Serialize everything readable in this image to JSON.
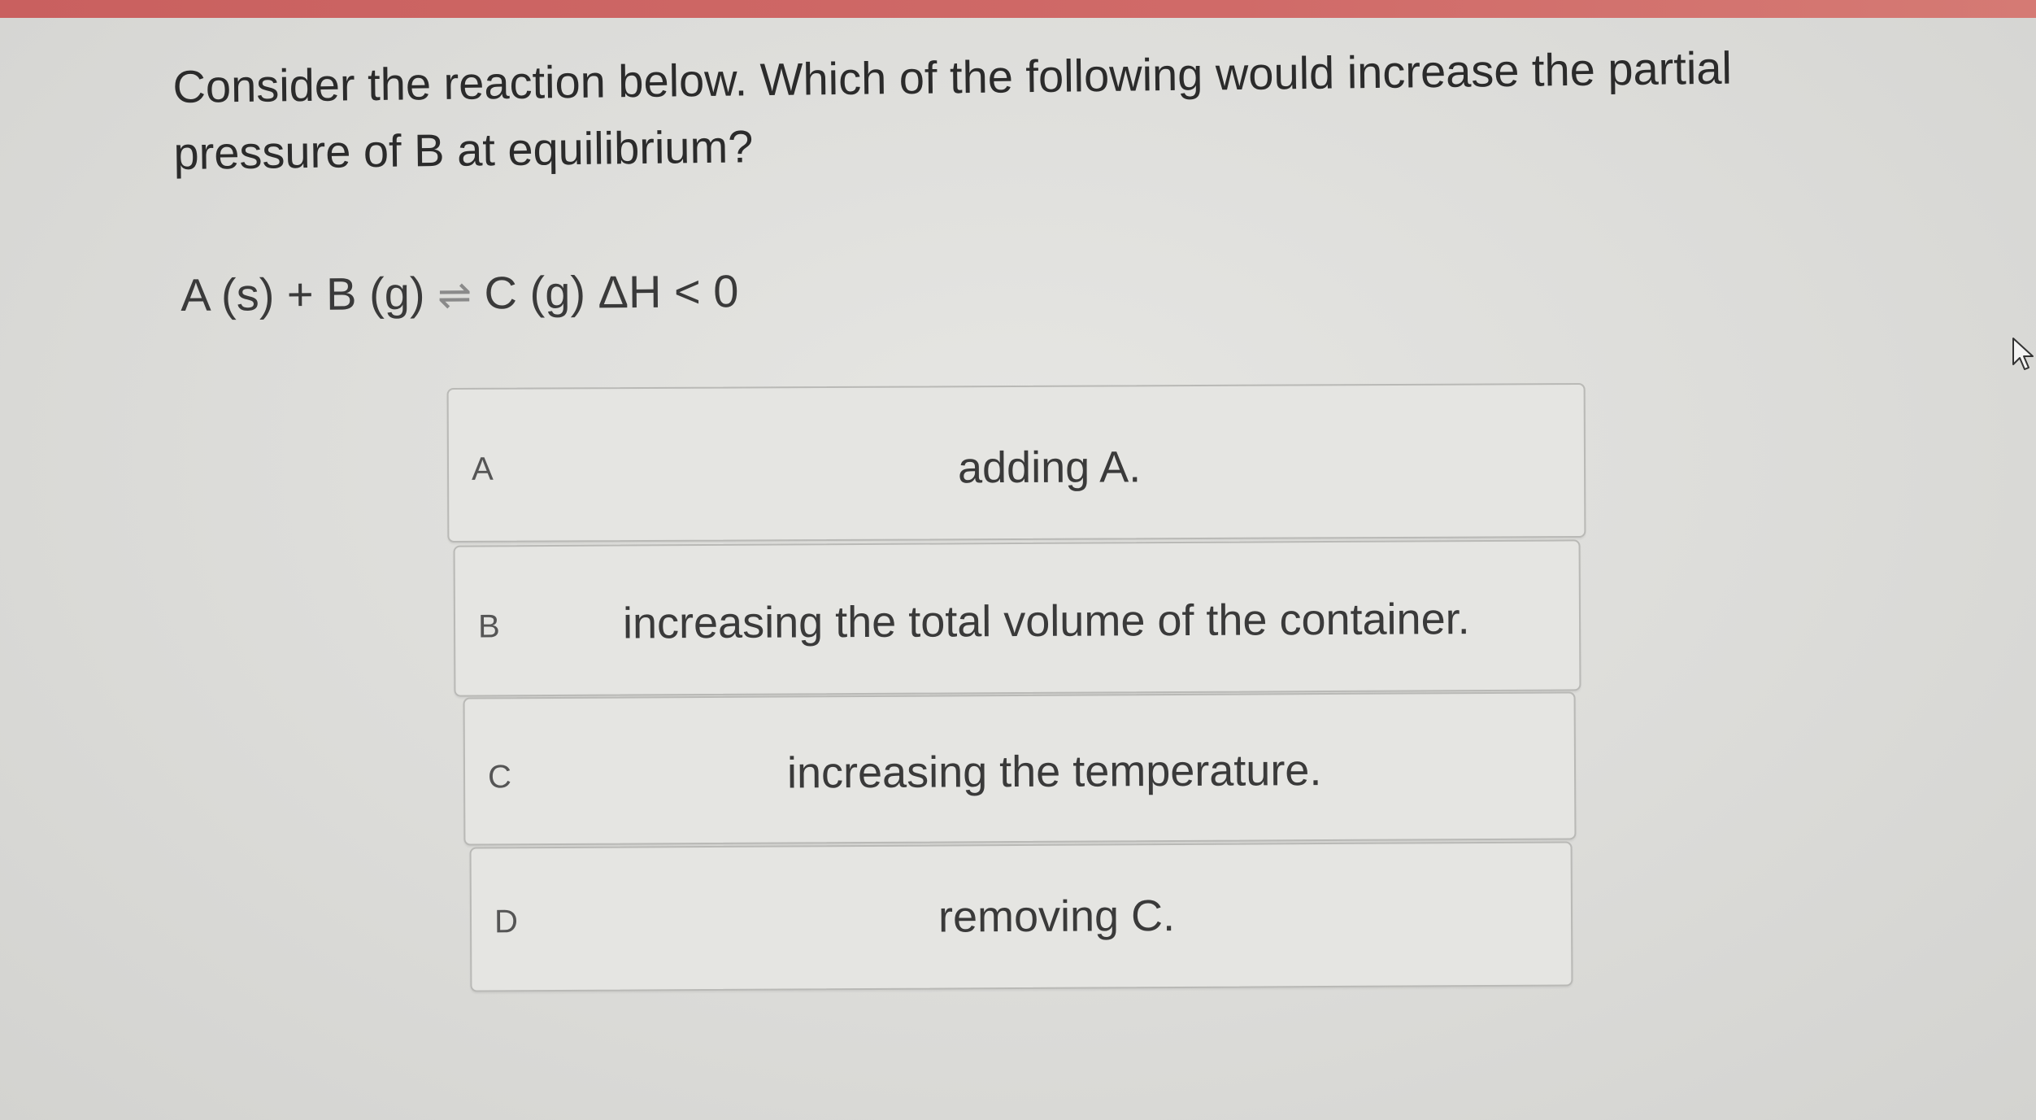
{
  "question": {
    "text": "Consider the reaction below. Which of the following would increase the partial pressure of B at equilibrium?",
    "equation_left": "A (s) + B (g)",
    "equation_arrow": "⇌",
    "equation_right": "C (g) ΔH < 0"
  },
  "options": [
    {
      "letter": "A",
      "text": "adding A."
    },
    {
      "letter": "B",
      "text": "increasing the total volume of the container."
    },
    {
      "letter": "C",
      "text": "increasing the temperature."
    },
    {
      "letter": "D",
      "text": "removing C."
    }
  ],
  "colors": {
    "top_bar": "#c9605f",
    "background": "#dcdcd9",
    "option_border": "#b9b9b6"
  },
  "icons": {
    "cursor": "mouse-pointer-icon"
  }
}
